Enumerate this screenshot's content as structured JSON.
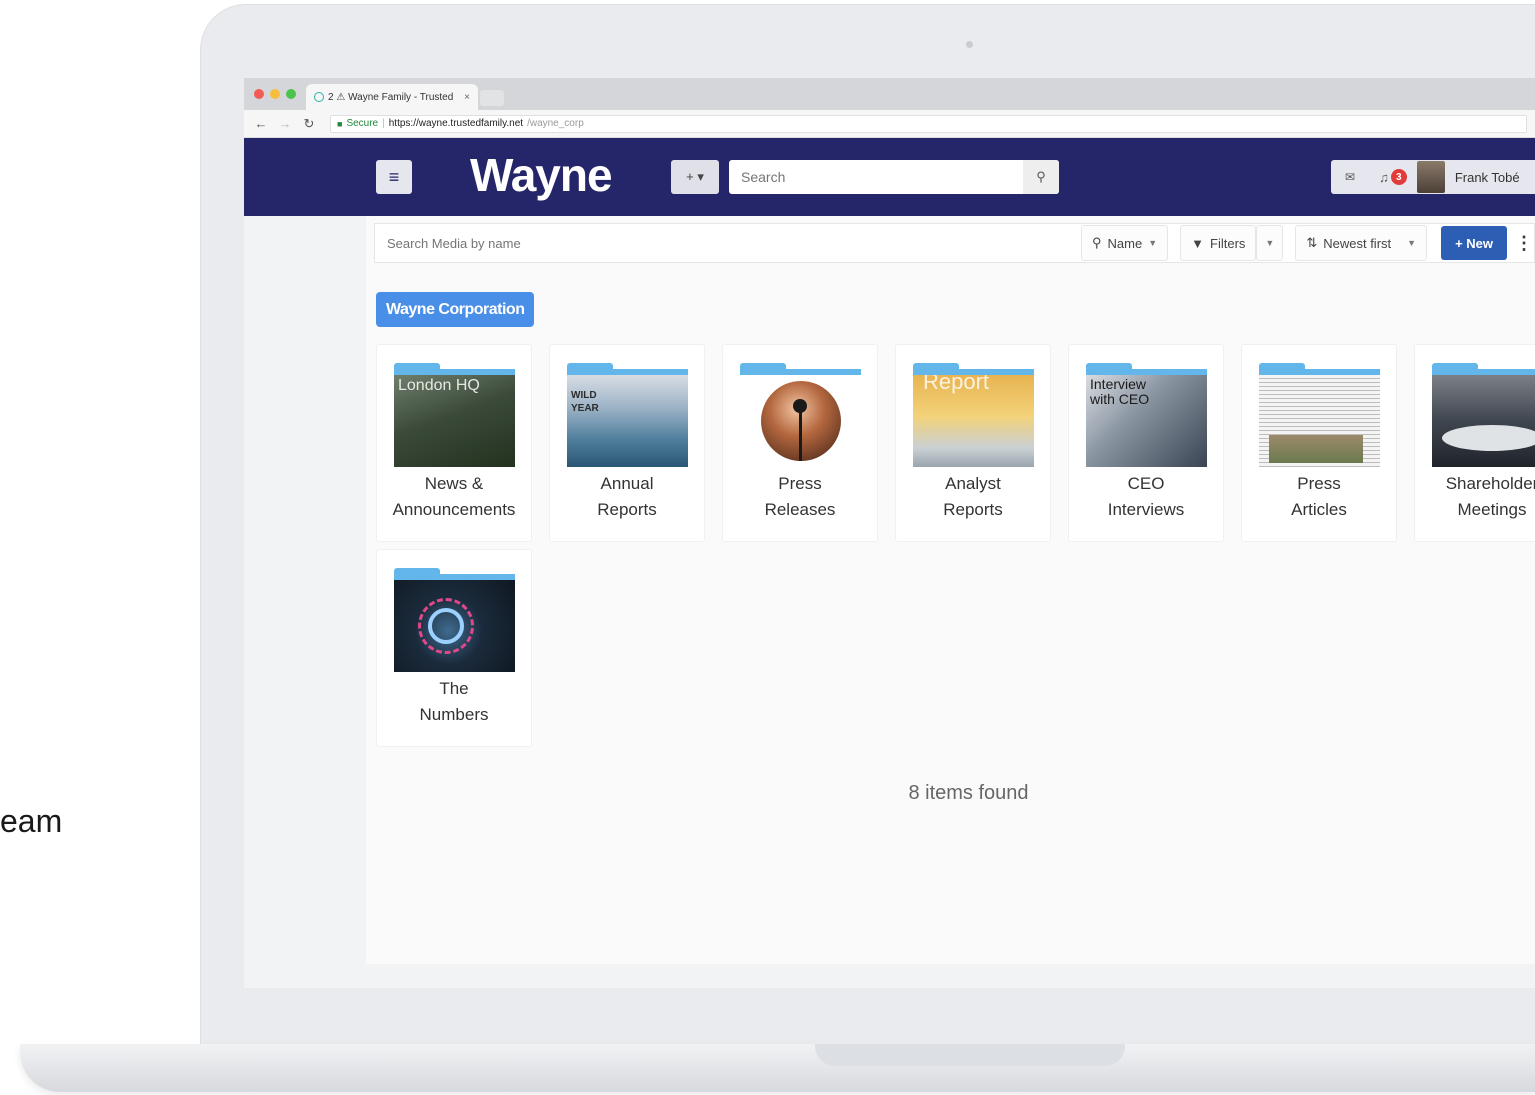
{
  "side_text": "eam",
  "browser": {
    "tab_title": "2 ⚠ Wayne Family - Trusted",
    "tab_close": "×",
    "url_secure": "Secure",
    "url_host": "https://wayne.trustedfamily.net",
    "url_path": "/wayne_corp"
  },
  "header": {
    "brand": "Wayne",
    "add_label": "+ ▾",
    "search_placeholder": "Search",
    "notification_count": "3",
    "user_name": "Frank Tobé"
  },
  "toolbar": {
    "search_placeholder": "Search Media by name",
    "name_label": "Name",
    "filters_label": "Filters",
    "sort_label": "Newest first",
    "new_label": "+ New"
  },
  "breadcrumb_chip": "Wayne Corporation",
  "folders": [
    {
      "line1": "News &",
      "line2": "Announcements",
      "thumb_text": "London HQ"
    },
    {
      "line1": "Annual",
      "line2": "Reports",
      "thumb_text": "WILD YEAR"
    },
    {
      "line1": "Press",
      "line2": "Releases",
      "thumb_text": ""
    },
    {
      "line1": "Analyst",
      "line2": "Reports",
      "thumb_text": "Report"
    },
    {
      "line1": "CEO",
      "line2": "Interviews",
      "thumb_text": "Interview with CEO"
    },
    {
      "line1": "Press",
      "line2": "Articles",
      "thumb_text": ""
    },
    {
      "line1": "Shareholder",
      "line2": "Meetings",
      "thumb_text": ""
    },
    {
      "line1": "The",
      "line2": "Numbers",
      "thumb_text": ""
    }
  ],
  "items_found": "8 items found",
  "colors": {
    "header_bg": "#25266a",
    "accent_blue": "#2c5fb3",
    "chip_blue": "#4a8fe7",
    "folder_blue": "#62b6ea",
    "badge_red": "#e23b3b"
  }
}
